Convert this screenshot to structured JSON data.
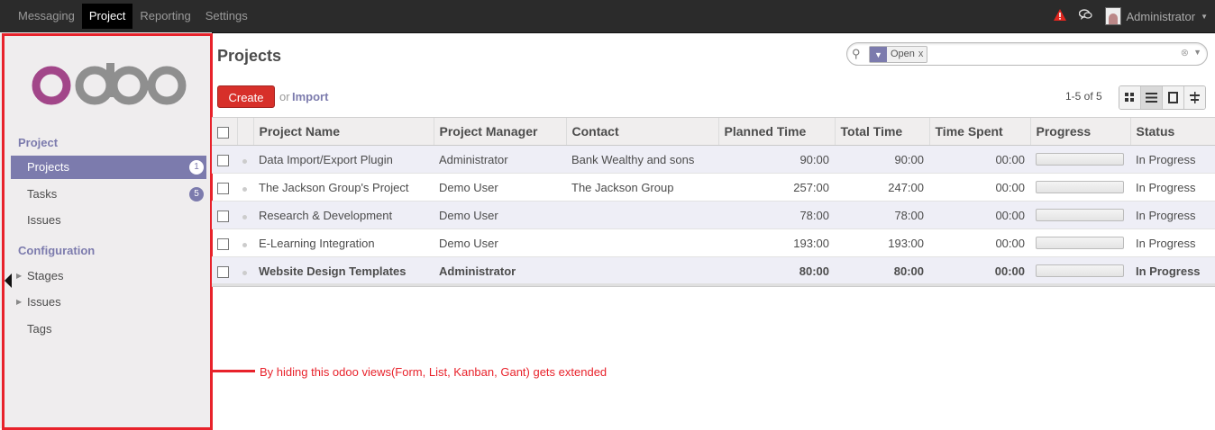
{
  "topbar": {
    "menu": [
      "Messaging",
      "Project",
      "Reporting",
      "Settings"
    ],
    "active": "Project",
    "user": "Administrator"
  },
  "sidebar": {
    "logo_text": "odoo",
    "sections": [
      {
        "heading": "Project",
        "items": [
          {
            "label": "Projects",
            "badge": "1",
            "active": true
          },
          {
            "label": "Tasks",
            "badge": "5"
          },
          {
            "label": "Issues"
          }
        ]
      },
      {
        "heading": "Configuration",
        "items": [
          {
            "label": "Stages",
            "expandable": true
          },
          {
            "label": "Issues",
            "expandable": true
          },
          {
            "label": "Tags"
          }
        ]
      }
    ]
  },
  "main": {
    "title": "Projects",
    "search": {
      "facet_value": "Open"
    },
    "create_label": "Create",
    "or_label": "or",
    "import_label": "Import",
    "pager": "1-5 of 5",
    "views": [
      "kanban-icon",
      "list-icon",
      "form-icon",
      "gantt-icon"
    ],
    "active_view": "list-icon"
  },
  "table": {
    "columns": [
      "Project Name",
      "Project Manager",
      "Contact",
      "Planned Time",
      "Total Time",
      "Time Spent",
      "Progress",
      "Status"
    ],
    "rows": [
      {
        "name": "Data Import/Export Plugin",
        "manager": "Administrator",
        "contact": "Bank Wealthy and sons",
        "planned": "90:00",
        "total": "90:00",
        "spent": "00:00",
        "progress": 0,
        "status": "In Progress"
      },
      {
        "name": "The Jackson Group's Project",
        "manager": "Demo User",
        "contact": "The Jackson Group",
        "planned": "257:00",
        "total": "247:00",
        "spent": "00:00",
        "progress": 0,
        "status": "In Progress"
      },
      {
        "name": "Research & Development",
        "manager": "Demo User",
        "contact": "",
        "planned": "78:00",
        "total": "78:00",
        "spent": "00:00",
        "progress": 0,
        "status": "In Progress"
      },
      {
        "name": "E-Learning Integration",
        "manager": "Demo User",
        "contact": "",
        "planned": "193:00",
        "total": "193:00",
        "spent": "00:00",
        "progress": 0,
        "status": "In Progress"
      },
      {
        "name": "Website Design Templates",
        "manager": "Administrator",
        "contact": "",
        "planned": "80:00",
        "total": "80:00",
        "spent": "00:00",
        "progress": 0,
        "status": "In Progress",
        "bold": true
      }
    ]
  },
  "annotation": "By hiding this odoo views(Form, List, Kanban, Gant) gets extended",
  "colors": {
    "accent": "#7c7bad",
    "create": "#d7302a",
    "highlight": "#e8222b"
  }
}
